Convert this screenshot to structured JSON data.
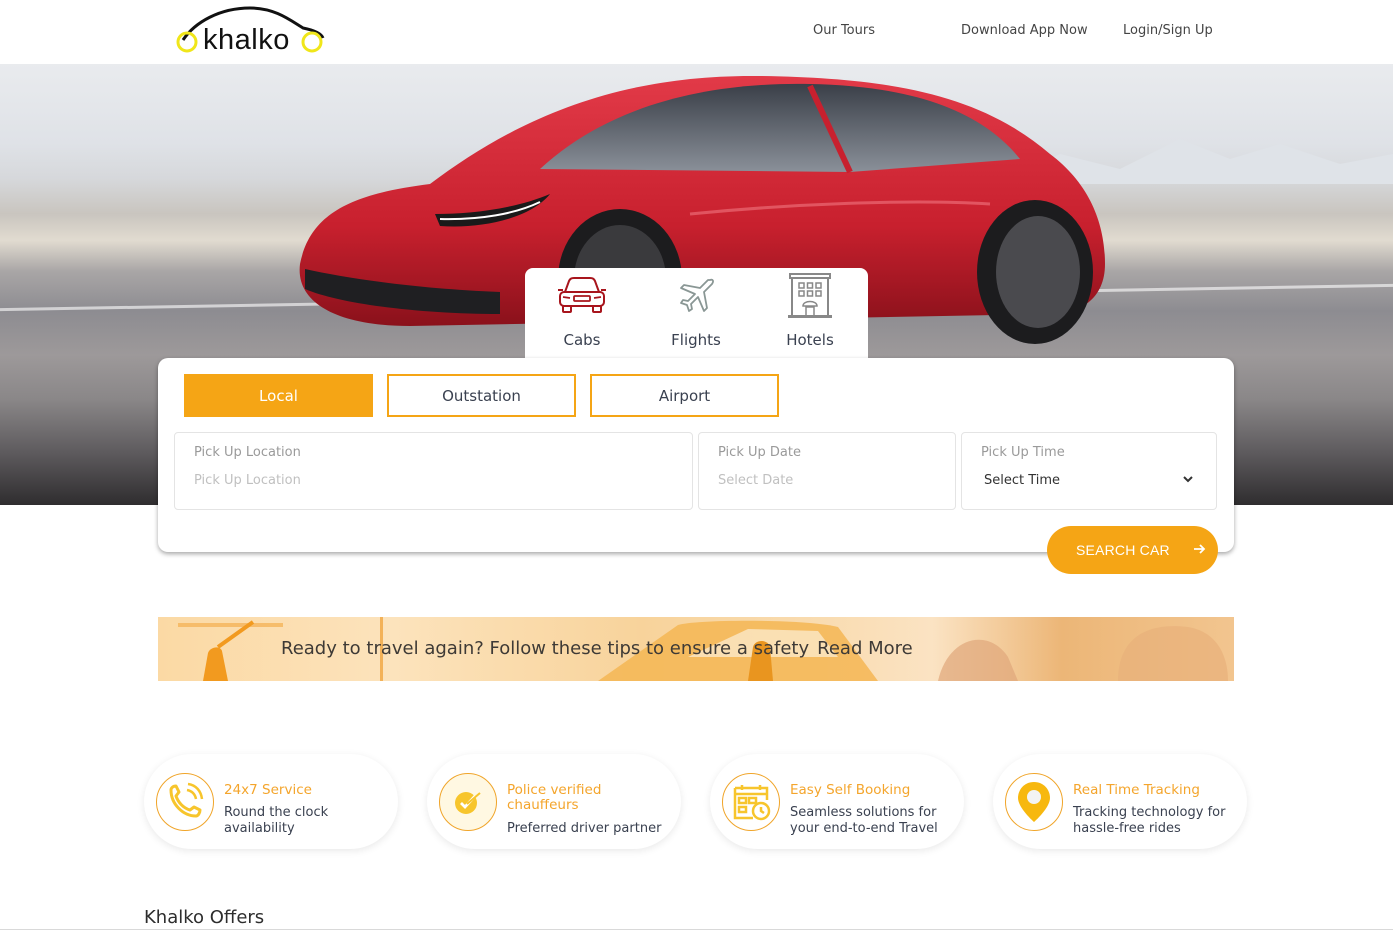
{
  "header": {
    "logo_text": "khalko",
    "nav": {
      "tours": "Our Tours",
      "app": "Download App Now",
      "login": "Login/Sign Up"
    }
  },
  "service_tabs": [
    {
      "label": "Cabs",
      "icon": "car-icon",
      "active": true
    },
    {
      "label": "Flights",
      "icon": "airplane-icon"
    },
    {
      "label": "Hotels",
      "icon": "hotel-building-icon"
    }
  ],
  "trip_types": [
    {
      "label": "Local",
      "active": true
    },
    {
      "label": "Outstation"
    },
    {
      "label": "Airport"
    }
  ],
  "form": {
    "pickup_location": {
      "label": "Pick Up Location",
      "placeholder": "Pick Up Location"
    },
    "pickup_date": {
      "label": "Pick Up Date",
      "placeholder": "Select Date"
    },
    "pickup_time": {
      "label": "Pick Up Time",
      "selected": "Select Time"
    },
    "search_button": "SEARCH CAR"
  },
  "banner": {
    "text": "Ready to travel again? Follow these tips to ensure a safety",
    "link": "Read More"
  },
  "features": [
    {
      "title": "24x7 Service",
      "desc_line1": "Round the clock",
      "desc_line2": "availability",
      "icon": "phone-call-icon"
    },
    {
      "title_line1": "Police verified",
      "title_line2": "chauffeurs",
      "desc": "Preferred driver partner",
      "icon": "verified-check-icon"
    },
    {
      "title": "Easy Self Booking",
      "desc_line1": "Seamless solutions for",
      "desc_line2": "your end-to-end Travel",
      "icon": "calendar-clock-icon"
    },
    {
      "title": "Real Time Tracking",
      "desc_line1": "Tracking technology for",
      "desc_line2": "hassle-free rides",
      "icon": "location-pin-icon"
    }
  ],
  "offers": {
    "title": "Khalko Offers"
  },
  "colors": {
    "accent": "#f5a515",
    "feature_title": "#f4a52c",
    "cab_icon": "#a8151d",
    "text_dark": "#3a4150"
  }
}
